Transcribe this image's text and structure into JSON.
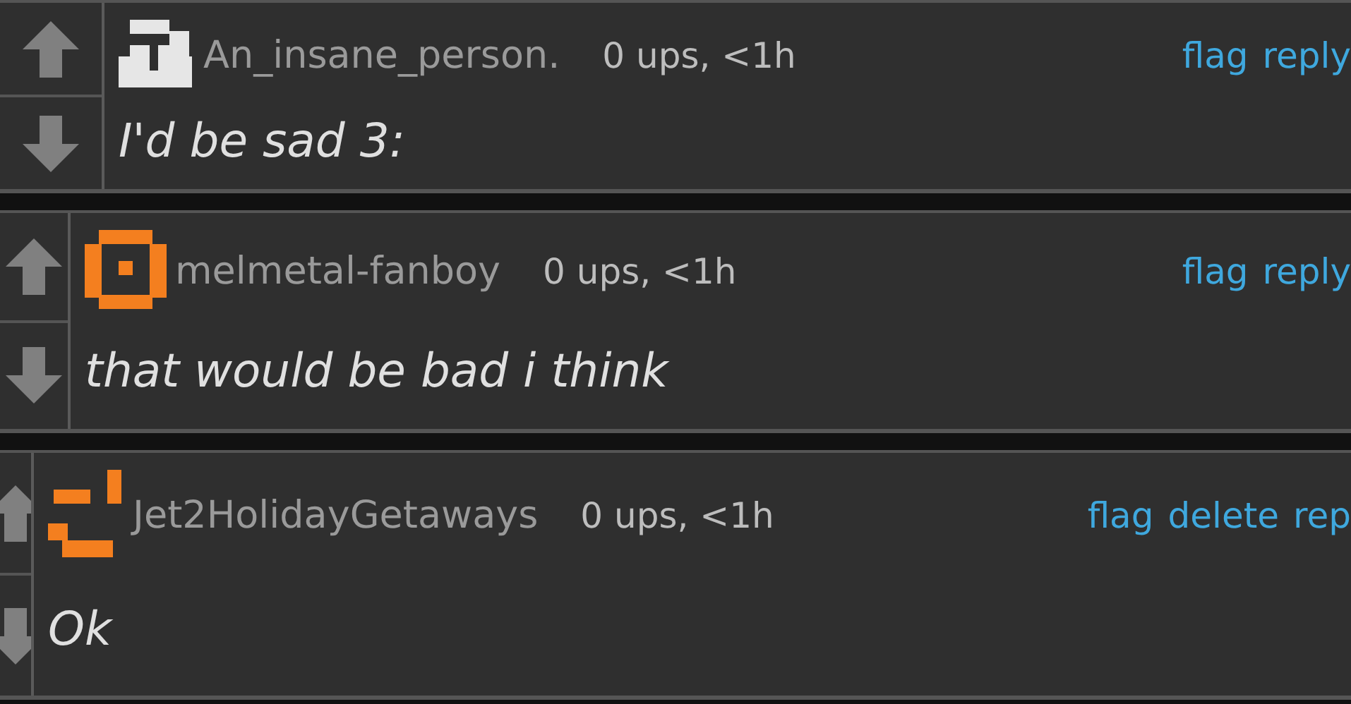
{
  "comments": [
    {
      "username": "An_insane_person.",
      "meta": "0 ups, <1h",
      "text": "I'd be sad 3:",
      "actions": [
        "flag",
        "reply"
      ]
    },
    {
      "username": "melmetal-fanboy",
      "meta": "0 ups, <1h",
      "text": "that would be bad i think",
      "actions": [
        "flag",
        "reply"
      ]
    },
    {
      "username": "Jet2HolidayGetaways",
      "meta": "0 ups, <1h",
      "text": "Ok",
      "actions": [
        "flag",
        "delete",
        "rep"
      ]
    }
  ]
}
